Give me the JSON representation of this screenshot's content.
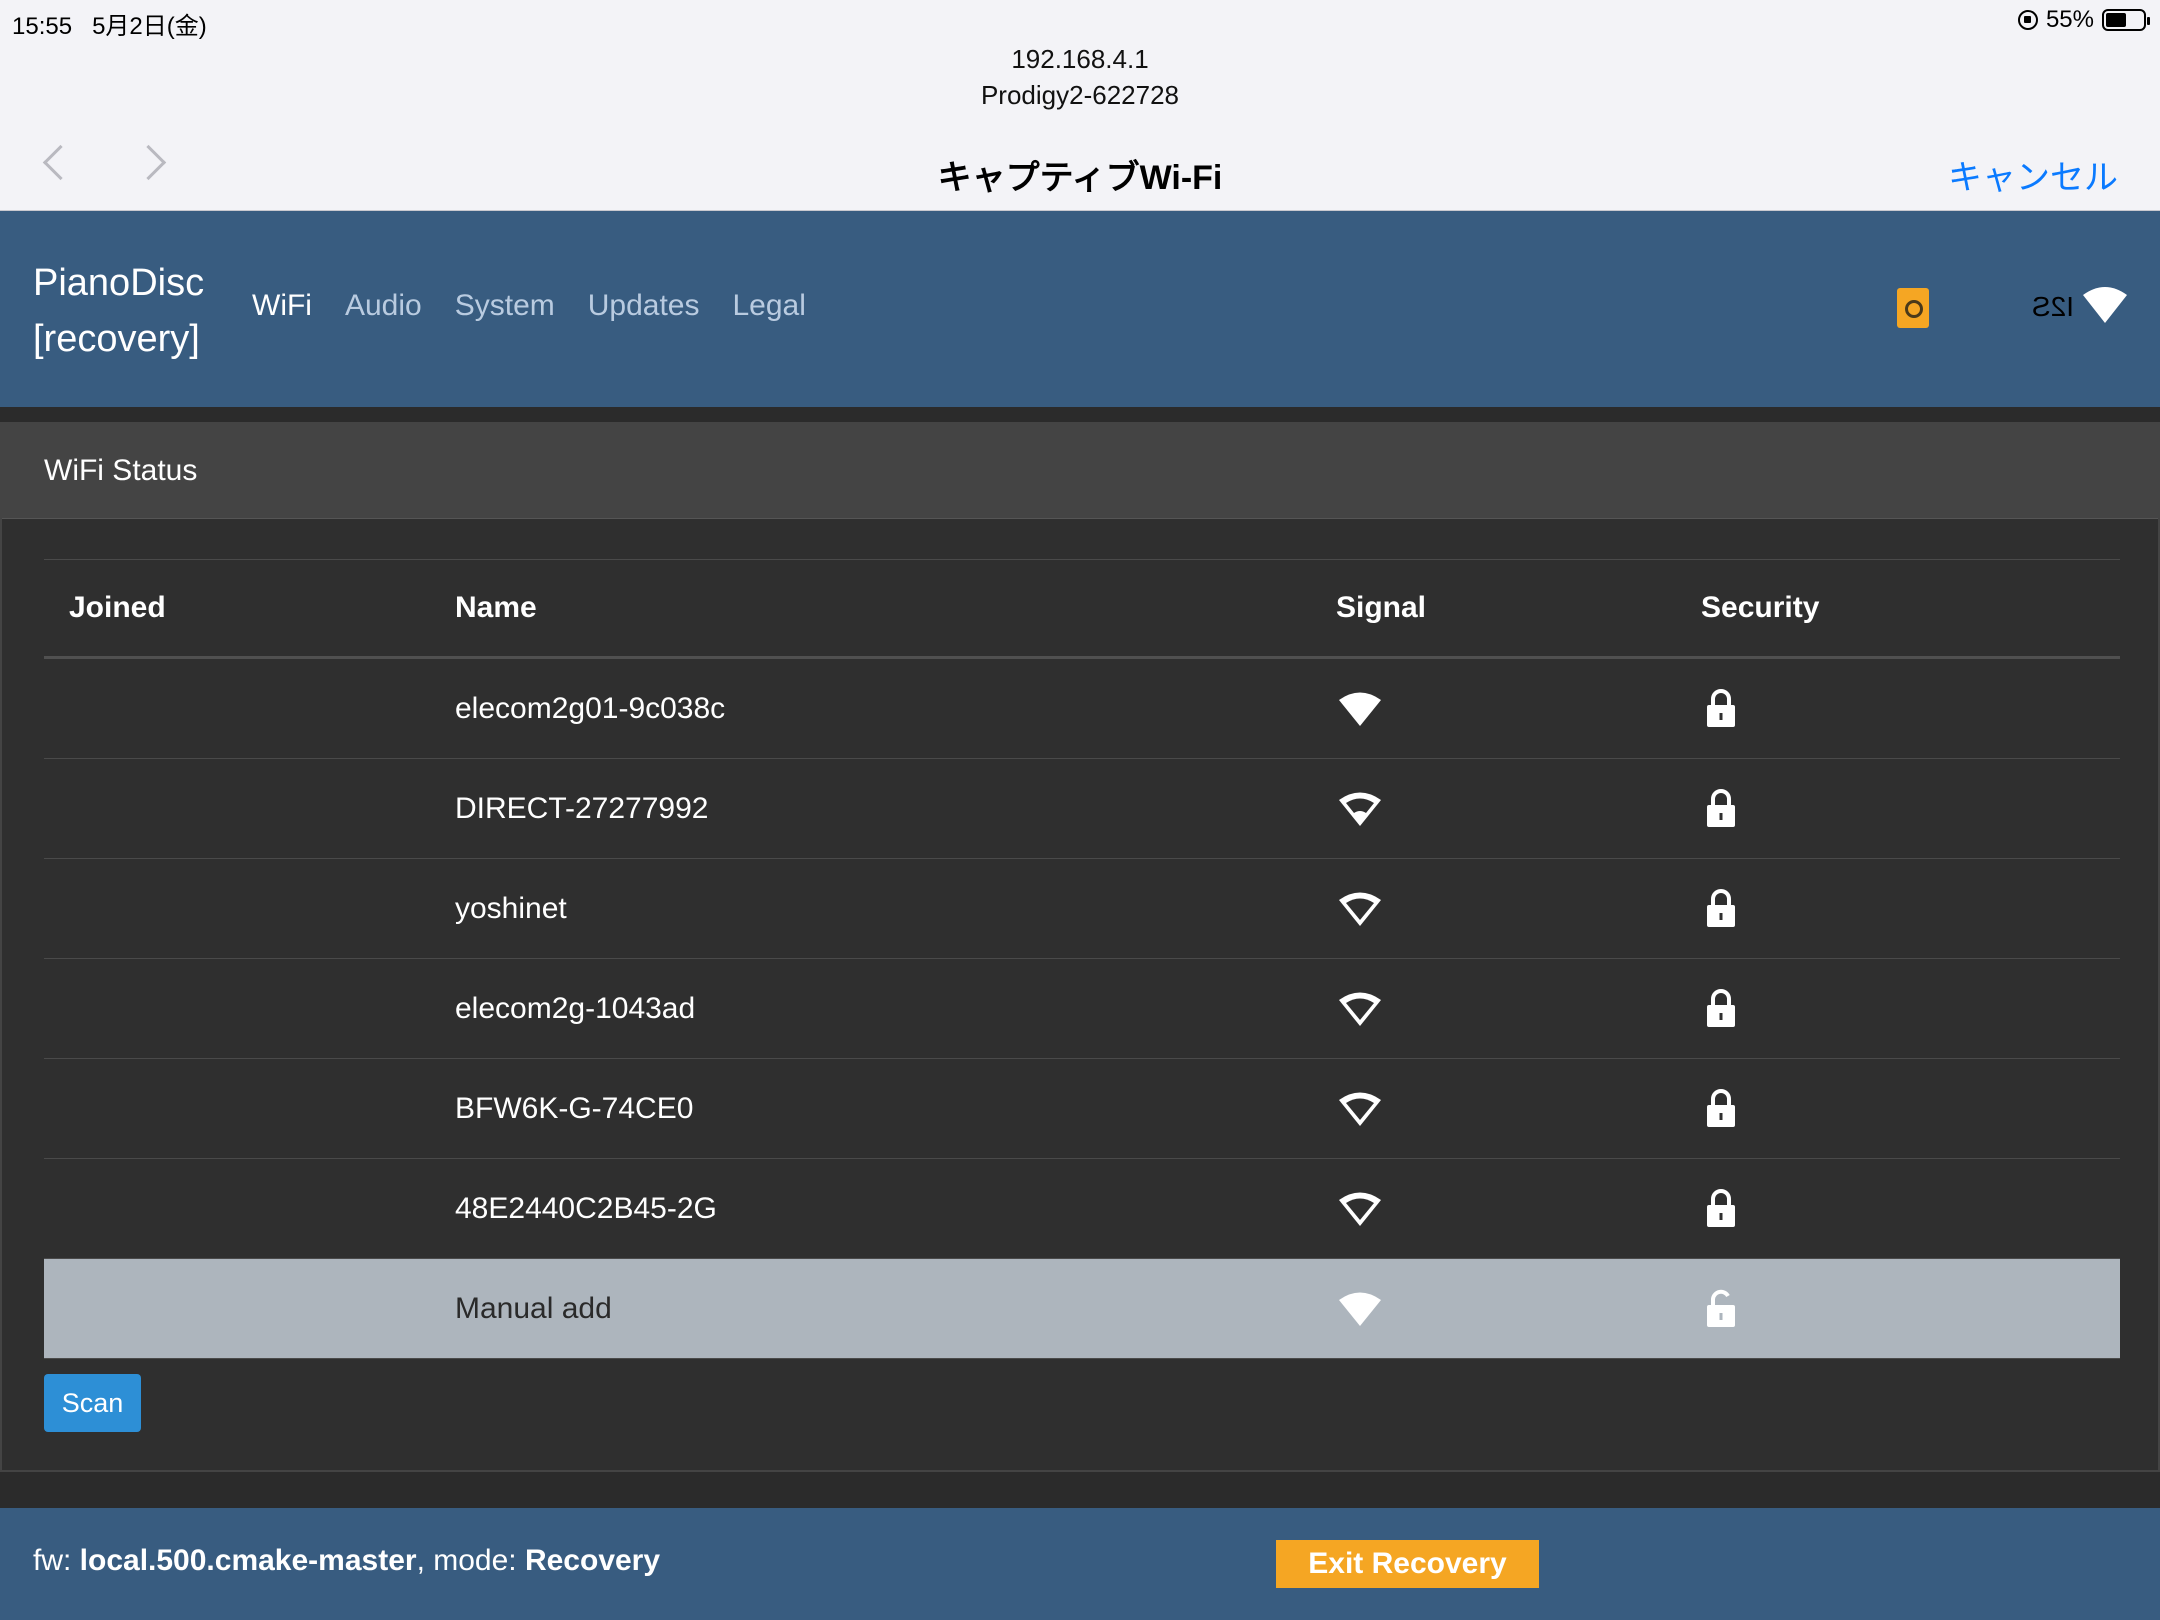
{
  "status_bar": {
    "time": "15:55",
    "date": "5月2日(金)",
    "battery": "55%",
    "battery_level": 0.55
  },
  "captive": {
    "host": "192.168.4.1",
    "network": "Prodigy2-622728",
    "title": "キャプティブWi-Fi",
    "cancel": "キャンセル"
  },
  "header": {
    "brand_line1": "PianoDisc",
    "brand_line2": "[recovery]",
    "nav": [
      "WiFi",
      "Audio",
      "System",
      "Updates",
      "Legal"
    ],
    "i2s_label": "I2S"
  },
  "panel": {
    "title": "WiFi Status",
    "columns": [
      "Joined",
      "Name",
      "Signal",
      "Security"
    ],
    "rows": [
      {
        "joined": "",
        "name": "elecom2g01-9c038c",
        "signal": 3,
        "locked": true
      },
      {
        "joined": "",
        "name": "DIRECT-27277992",
        "signal": 1,
        "locked": true
      },
      {
        "joined": "",
        "name": "yoshinet",
        "signal": 0,
        "locked": true
      },
      {
        "joined": "",
        "name": "elecom2g-1043ad",
        "signal": 0,
        "locked": true
      },
      {
        "joined": "",
        "name": "BFW6K-G-74CE0",
        "signal": 0,
        "locked": true
      },
      {
        "joined": "",
        "name": "48E2440C2B45-2G",
        "signal": 0,
        "locked": true
      },
      {
        "joined": "",
        "name": "Manual add",
        "signal": 3,
        "locked": false,
        "selected": true
      }
    ],
    "scan_label": "Scan"
  },
  "footer": {
    "fw_label": "fw: ",
    "fw_value": "local.500.cmake-master",
    "mode_label": ", mode: ",
    "mode_value": "Recovery",
    "exit_label": "Exit Recovery"
  },
  "colors": {
    "header_bg": "#385c80",
    "accent": "#f5a623",
    "link": "#0a7aff",
    "scan": "#2d8fd6"
  }
}
